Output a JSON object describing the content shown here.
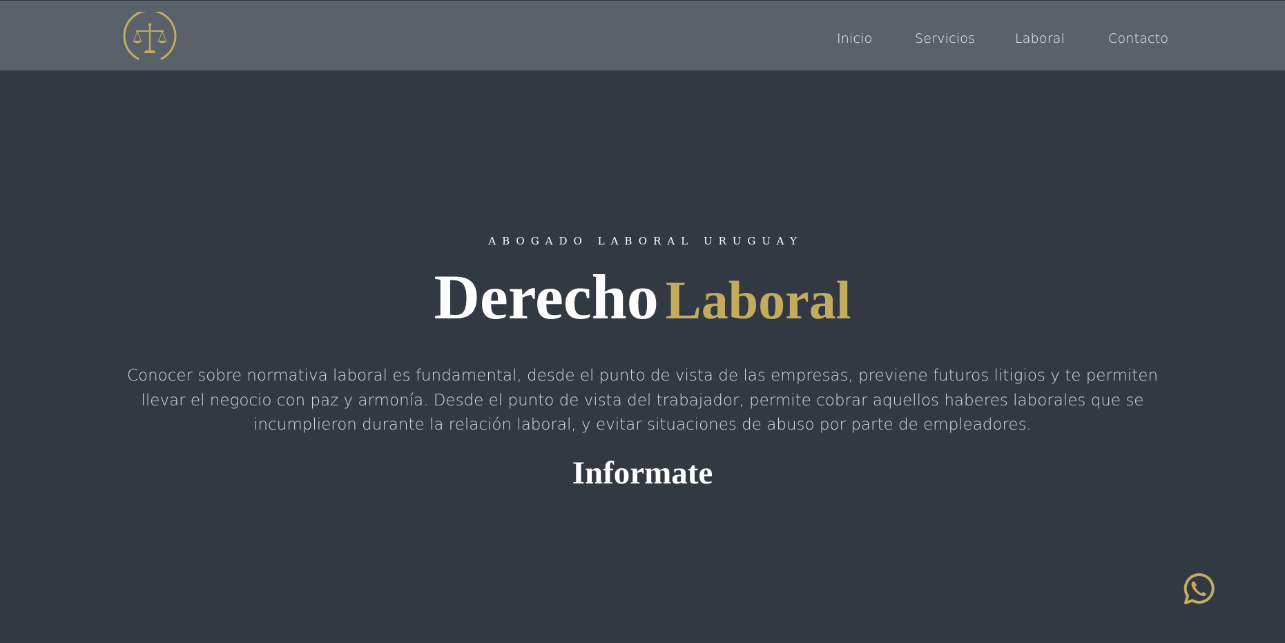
{
  "header": {
    "logo_icon": "scales-of-justice-icon",
    "nav": [
      {
        "label": "Inicio"
      },
      {
        "label": "Servicios"
      },
      {
        "label": "Laboral"
      },
      {
        "label": "Contacto"
      }
    ]
  },
  "hero": {
    "eyebrow": "ABOGADO LABORAL URUGUAY",
    "title_part1": "Derecho",
    "title_part2": "Laboral",
    "description_lines": [
      "Conocer sobre normativa laboral es fundamental, desde el punto de vista de las empresas, previene futuros litigios y te permiten",
      "llevar el negocio con paz y armonía. Desde el punto de vista del trabajador, permite cobrar aquellos haberes laborales que se",
      "incumplieron durante la relación laboral, y evitar situaciones de abuso por parte de empleadores."
    ],
    "cta_heading": "Informate"
  },
  "floating": {
    "whatsapp_icon": "whatsapp-icon"
  },
  "colors": {
    "header_bg": "#5b616a",
    "page_bg": "#323943",
    "accent_gold": "#c3ac5e",
    "text_light": "#ffffff"
  }
}
